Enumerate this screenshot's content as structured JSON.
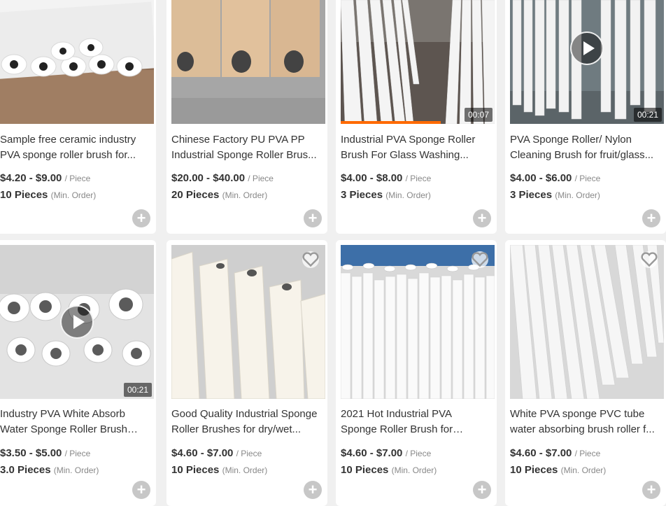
{
  "products": [
    {
      "title": "Sample free ceramic industry PVA sponge roller brush for...",
      "price": "$4.20 - $9.00",
      "unit": "/ Piece",
      "moq": "10 Pieces",
      "moq_unit": "(Min. Order)"
    },
    {
      "title": "Chinese Factory PU PVA PP Industrial Sponge Roller Brus...",
      "price": "$20.00 - $40.00",
      "unit": "/ Piece",
      "moq": "20 Pieces",
      "moq_unit": "(Min. Order)"
    },
    {
      "title": "Industrial PVA Sponge Roller Brush For Glass Washing...",
      "price": "$4.00 - $8.00",
      "unit": "/ Piece",
      "moq": "3 Pieces",
      "moq_unit": "(Min. Order)",
      "duration": "00:07",
      "video_progress": 0.65
    },
    {
      "title": "PVA Sponge Roller/ Nylon Cleaning Brush for fruit/glass...",
      "price": "$4.00 - $6.00",
      "unit": "/ Piece",
      "moq": "3 Pieces",
      "moq_unit": "(Min. Order)",
      "duration": "00:21"
    },
    {
      "title": "Industry PVA White Absorb Water Sponge Roller Brush for...",
      "price": "$3.50 - $5.00",
      "unit": "/ Piece",
      "moq": "3.0 Pieces",
      "moq_unit": "(Min. Order)",
      "duration": "00:21"
    },
    {
      "title": "Good Quality Industrial Sponge Roller Brushes for dry/wet...",
      "price": "$4.60 - $7.00",
      "unit": "/ Piece",
      "moq": "10 Pieces",
      "moq_unit": "(Min. Order)"
    },
    {
      "title": "2021 Hot Industrial PVA Sponge Roller Brush for Glass...",
      "price": "$4.60 - $7.00",
      "unit": "/ Piece",
      "moq": "10 Pieces",
      "moq_unit": "(Min. Order)"
    },
    {
      "title": "White PVA sponge PVC tube water absorbing brush roller f...",
      "price": "$4.60 - $7.00",
      "unit": "/ Piece",
      "moq": "10 Pieces",
      "moq_unit": "(Min. Order)"
    }
  ],
  "icons": {
    "add": "plus-icon",
    "favorite": "heart-icon",
    "play": "play-icon"
  },
  "colors": {
    "accent": "#ff6a00",
    "text": "#333333",
    "muted": "#888888",
    "add_button": "#c7c7c7"
  }
}
